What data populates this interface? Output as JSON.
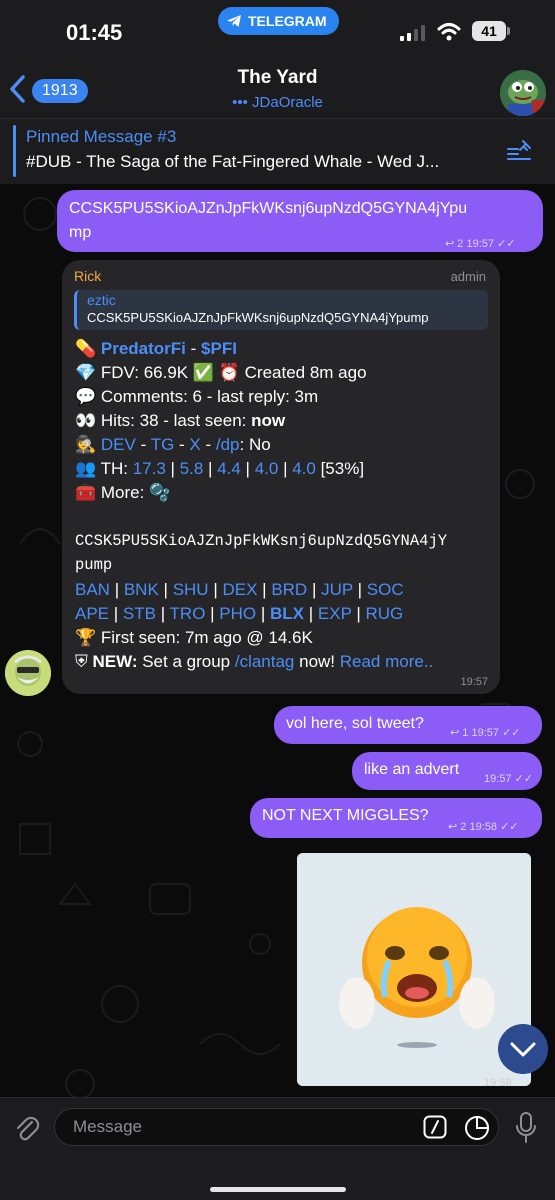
{
  "status_bar": {
    "time": "01:45",
    "app_pill": "TELEGRAM",
    "battery": "41"
  },
  "header": {
    "back_count": "1913",
    "title": "The Yard",
    "subtitle": "••• JDaOracle"
  },
  "pinned": {
    "title": "Pinned Message #3",
    "text": "#DUB - The Saga of the Fat-Fingered Whale - Wed J..."
  },
  "messages": {
    "m1": {
      "lines": [
        "CCSK5PU5SKioAJZnJpFkWKsnj6upNzdQ5GYNA4jYpu",
        "mp"
      ],
      "replies": "2",
      "time": "19:57"
    },
    "bot": {
      "sender": "Rick",
      "role": "admin",
      "reply_name": "eztic",
      "reply_text": "CCSK5PU5SKioAJZnJpFkWKsnj6upNzdQ5GYNA4jYpump",
      "token_name": "PredatorFi",
      "sep": " - ",
      "ticker": "$PFI",
      "fdv": "💎 FDV: 66.9K ✅ ⏰ Created 8m ago",
      "comments": "💬 Comments: 6 - last reply: 3m",
      "hits_prefix": "👀 Hits: 38 - last seen: ",
      "hits_bold": "now",
      "dev_icon": "🕵",
      "dev_links": [
        "DEV",
        "TG",
        "X",
        "/dp"
      ],
      "dev_suffix": ": No",
      "th_prefix": "👥 TH: ",
      "th_values": [
        "17.3",
        "5.8",
        "4.4",
        "4.0",
        "4.0"
      ],
      "th_suffix": " [53%]",
      "more": "🧰 More: 🫧",
      "ca_line1": "CCSK5PU5SKioAJZnJpFkWKsnj6upNzdQ5GYNA4jY",
      "ca_line2": "pump",
      "links_row1": [
        "BAN",
        "BNK",
        "SHU",
        "DEX",
        "BRD",
        "JUP",
        "SOC"
      ],
      "links_row2": [
        "APE",
        "STB",
        "TRO",
        "PHO",
        "BLX",
        "EXP",
        "RUG"
      ],
      "first_seen": "🏆 First seen: 7m ago @ 14.6K",
      "new_label": "NEW:",
      "new_text": " Set a group ",
      "clantag": "/clantag",
      "new_text2": " now! ",
      "read_more": "Read more..",
      "time": "19:57"
    },
    "m2": {
      "text": "vol here, sol tweet?",
      "replies": "1",
      "time": "19:57"
    },
    "m3": {
      "text": "like an advert",
      "time": "19:57"
    },
    "m4": {
      "text": "NOT NEXT MIGGLES?",
      "replies": "2",
      "time": "19:58"
    },
    "m5": {
      "time": "19:58"
    }
  },
  "input": {
    "placeholder": "Message"
  },
  "colors": {
    "outgoing": "#8b5cf6",
    "link": "#4c8df6",
    "incoming": "#262628",
    "admin_name": "#f0a848"
  },
  "icons": [
    "telegram-icon",
    "back-chevron-icon",
    "pin-list-icon",
    "reply-arrow-icon",
    "double-check-icon",
    "attach-icon",
    "command-icon",
    "sticker-icon",
    "mic-icon",
    "chevron-down-icon"
  ]
}
